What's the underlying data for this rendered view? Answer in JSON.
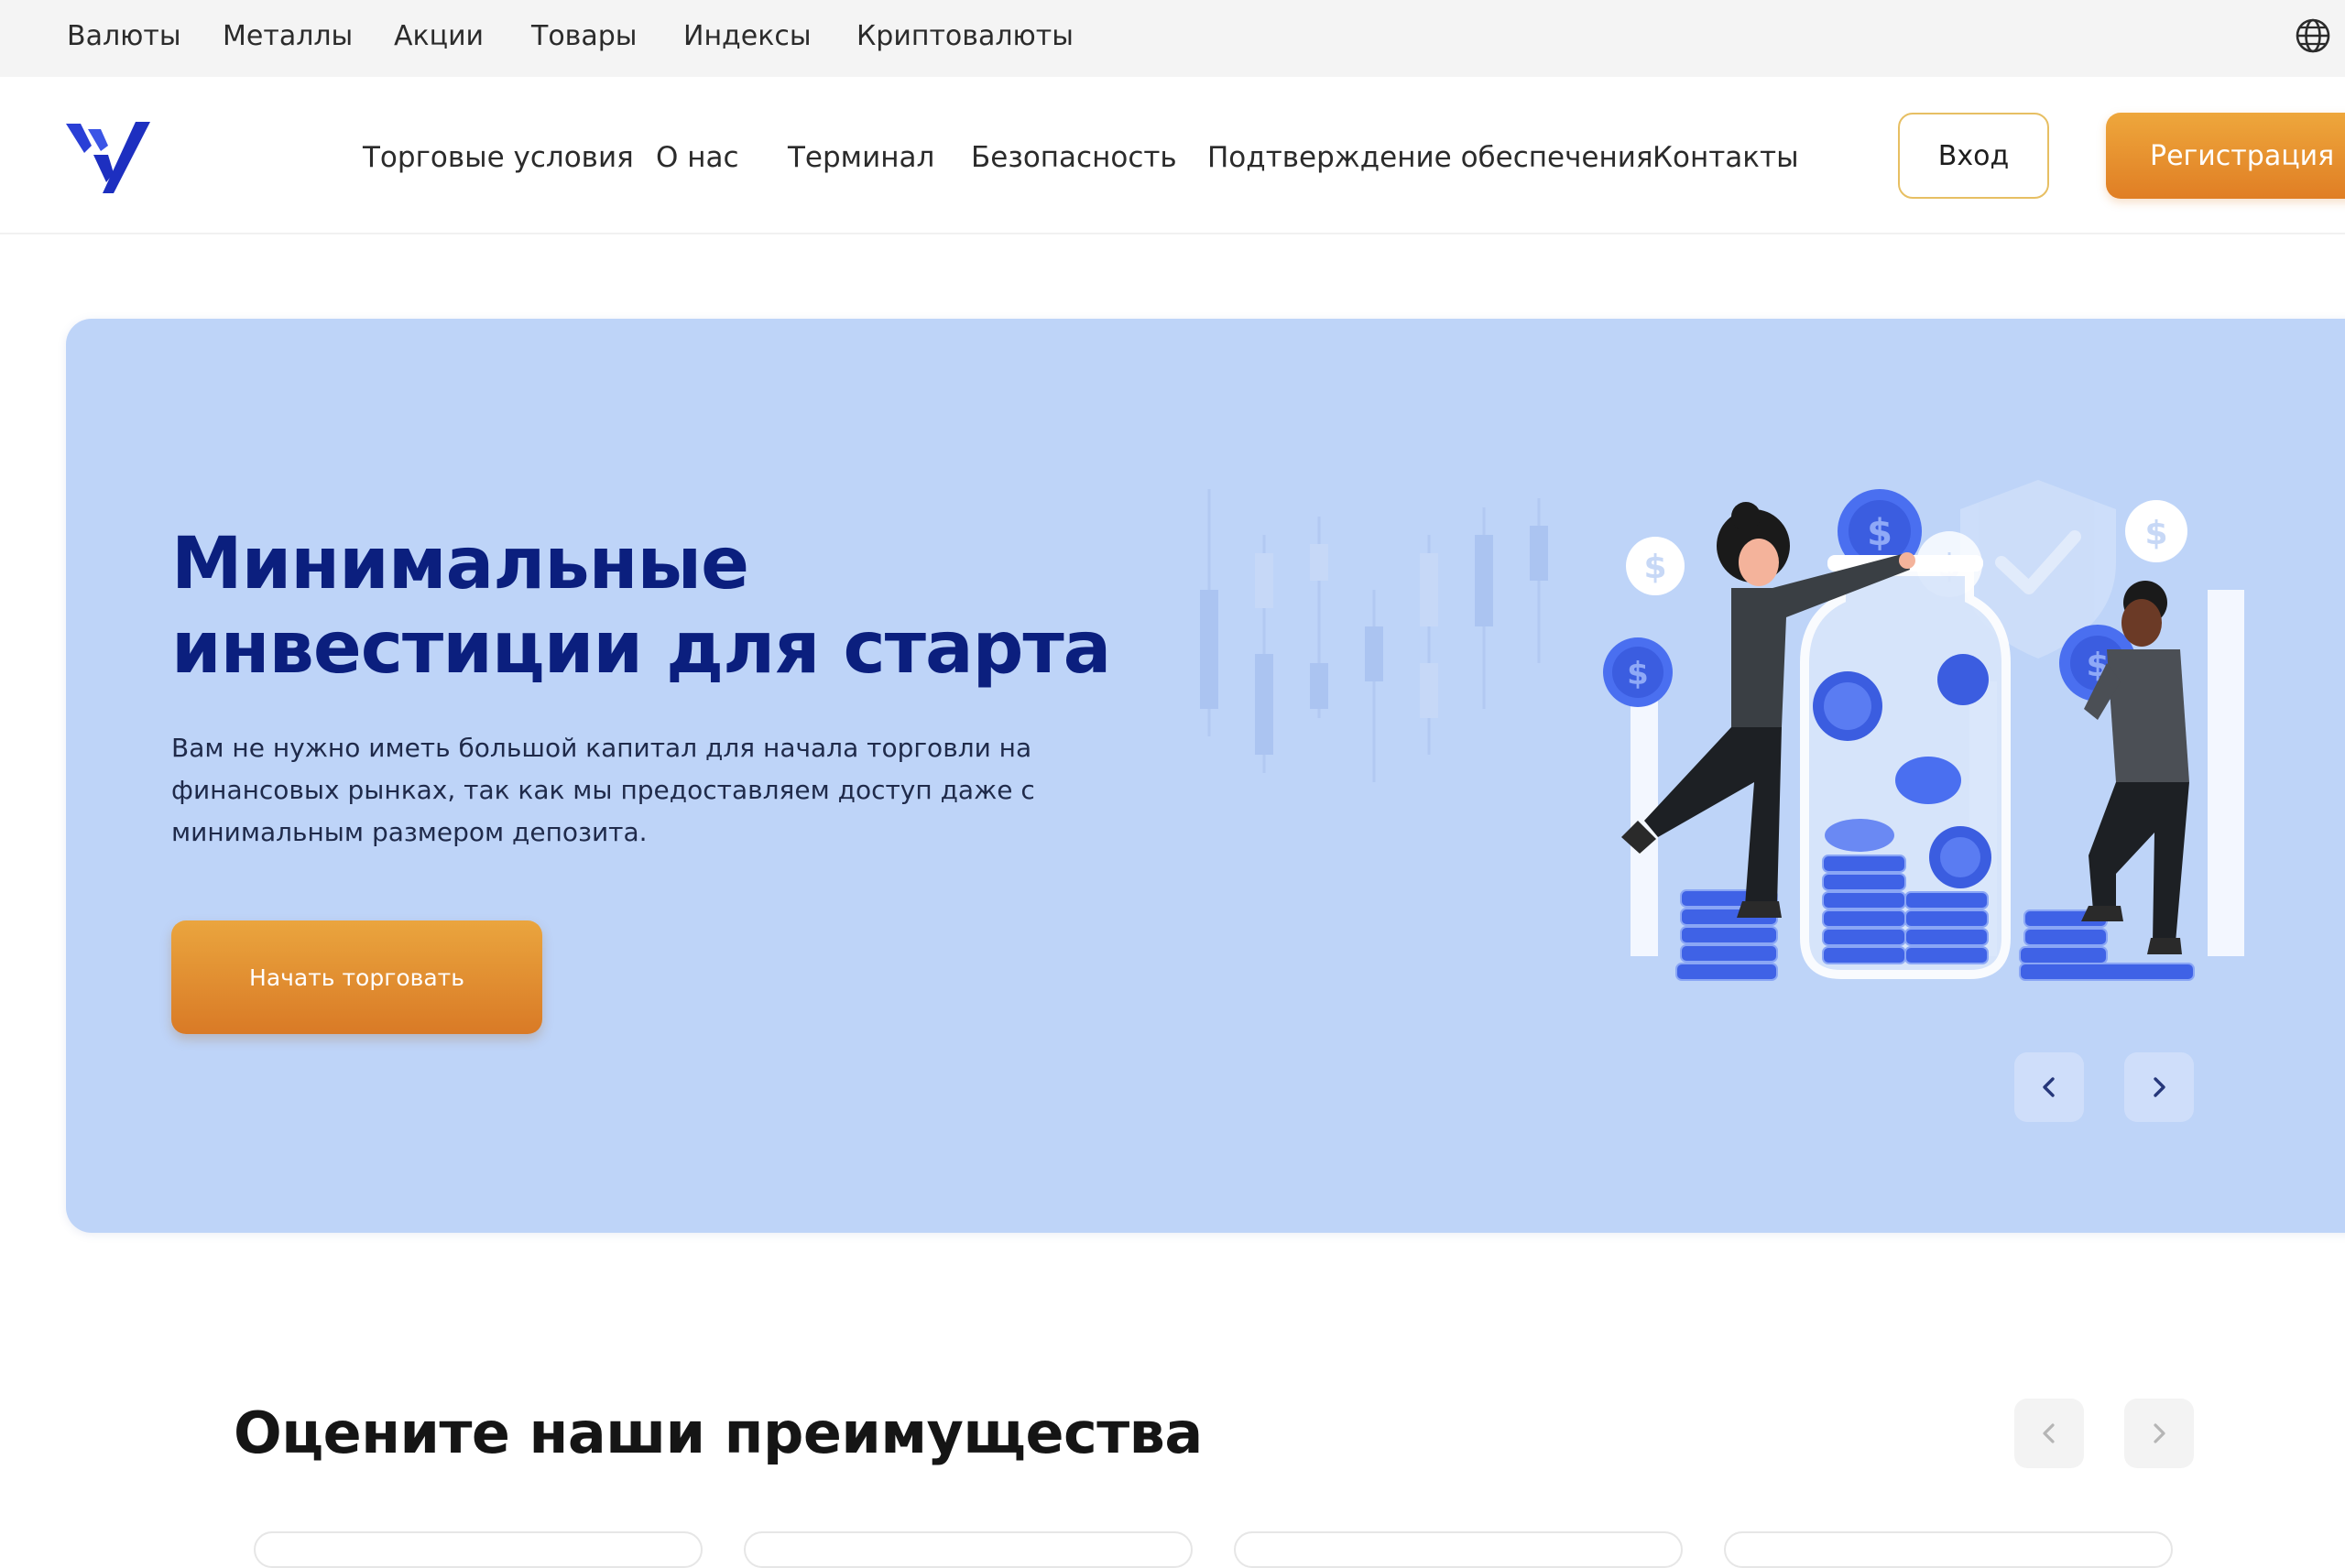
{
  "topbar": {
    "items": [
      "Валюты",
      "Металлы",
      "Акции",
      "Товары",
      "Индексы",
      "Криптовалюты"
    ],
    "language_icon": "globe-icon"
  },
  "header": {
    "logo_icon": "brand-logo",
    "nav": [
      "Торговые условия",
      "О нас",
      "Терминал",
      "Безопасность",
      "Подтверждение обеспечения",
      "Контакты"
    ],
    "login_label": "Вход",
    "register_label": "Регистрация"
  },
  "hero": {
    "title": "Минимальные инвестиции для старта",
    "text": "Вам не нужно иметь большой капитал для начала торговли на финансовых рынках, так как мы предоставляем доступ даже с минимальным размером депозита.",
    "cta_label": "Начать торговать",
    "prev_icon": "chevron-left-icon",
    "next_icon": "chevron-right-icon"
  },
  "advantages": {
    "title": "Оцените наши преимущества",
    "prev_icon": "chevron-left-icon",
    "next_icon": "chevron-right-icon"
  },
  "colors": {
    "hero_bg": "#bed4f8",
    "title_navy": "#0b1f7e",
    "accent_orange": "#e07e24",
    "login_border": "#e7bf63",
    "logo_blue": "#2a3fd6"
  }
}
